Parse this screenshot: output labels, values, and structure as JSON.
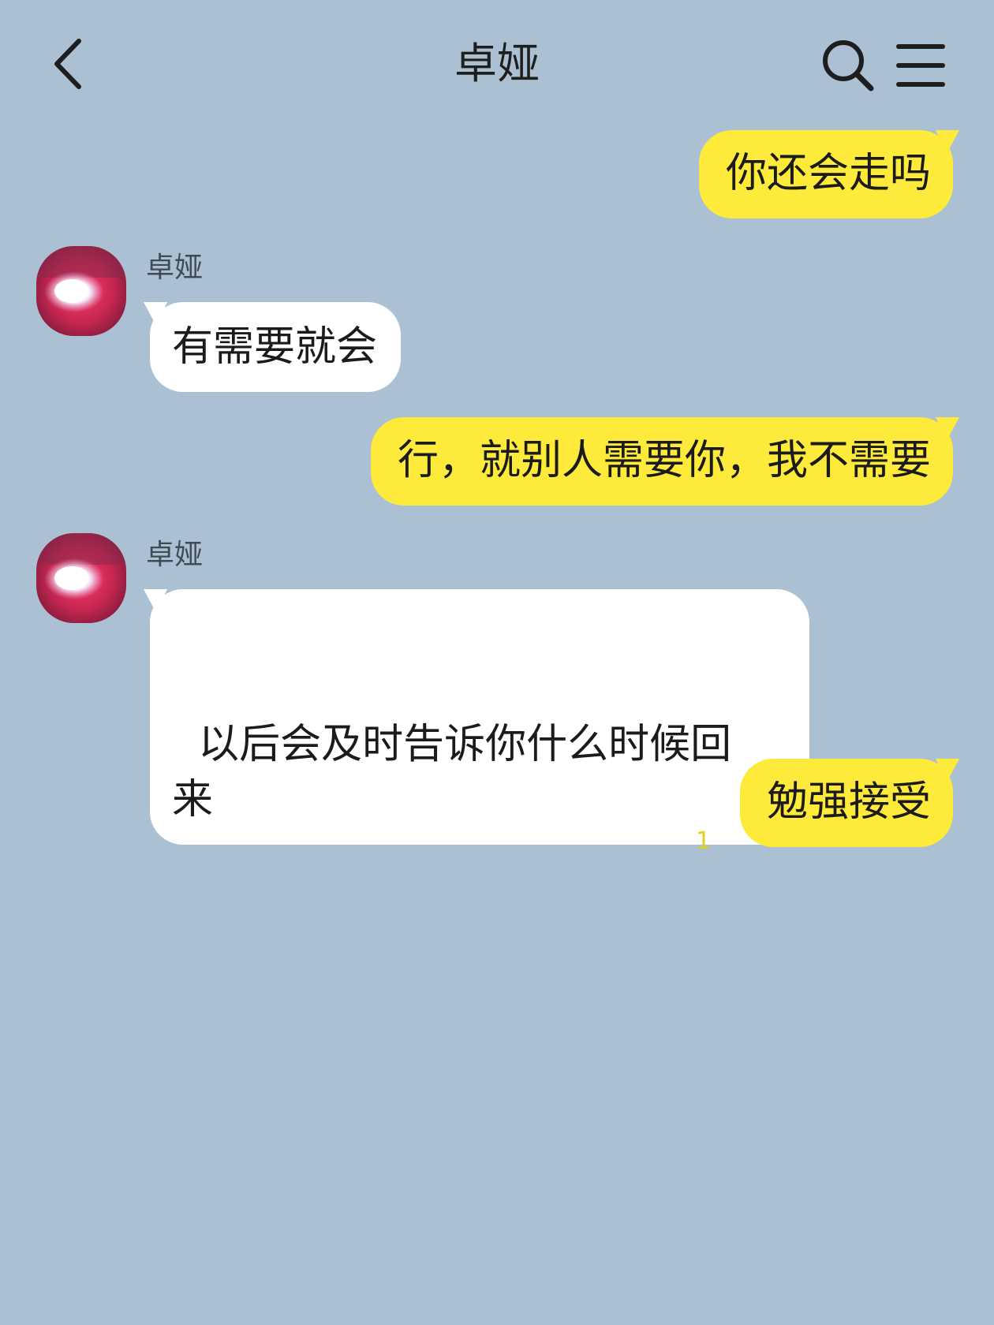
{
  "header": {
    "title": "卓娅"
  },
  "messages": [
    {
      "side": "sent",
      "text": "你还会走吗"
    },
    {
      "side": "received",
      "sender": "卓娅",
      "text": "有需要就会"
    },
    {
      "side": "sent",
      "text": "行，就别人需要你，我不需要"
    },
    {
      "side": "received",
      "sender": "卓娅",
      "text": "以后会及时告诉你什么时候回\n来"
    },
    {
      "side": "sent",
      "text": "勉强接受",
      "unread_count": "1"
    }
  ],
  "colors": {
    "background": "#abc1d3",
    "sent_bubble": "#fdea3a",
    "received_bubble": "#ffffff",
    "unread_count": "#e6cf1a"
  },
  "icons": [
    "back-arrow-icon",
    "search-icon",
    "menu-icon"
  ]
}
